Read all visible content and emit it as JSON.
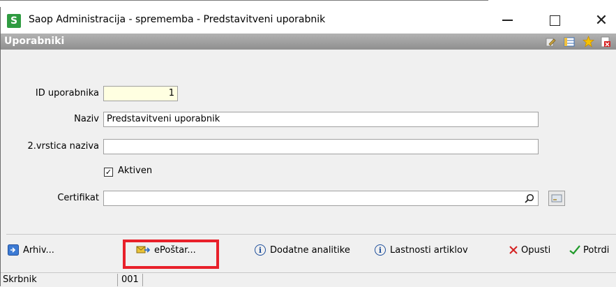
{
  "window": {
    "app_icon_letter": "S",
    "title": "Saop Administracija - sprememba - Predstavitveni uporabnik",
    "minimize_glyph": "minimize",
    "maximize_glyph": "maximize",
    "close_glyph": "✕"
  },
  "header": {
    "title": "Uporabniki",
    "toolbar_icons": [
      "edit-icon",
      "table-icon",
      "star-icon",
      "delete-icon",
      "users-icon"
    ]
  },
  "form": {
    "id_label": "ID uporabnika",
    "id_value": "1",
    "naziv_label": "Naziv",
    "naziv_value": "Predstavitveni uporabnik",
    "vrstica2_label": "2.vrstica naziva",
    "vrstica2_value": "",
    "aktiven_label": "Aktiven",
    "aktiven_checked": true,
    "certifikat_label": "Certifikat",
    "certifikat_value": ""
  },
  "buttons": {
    "arhiv": "Arhiv...",
    "epostar": "ePoštar...",
    "dodatne_analitike": "Dodatne analitike",
    "lastnosti_artiklov": "Lastnosti artiklov",
    "opusti": "Opusti",
    "potrdi": "Potrdi"
  },
  "status": {
    "skrbnik": "Skrbnik",
    "code": "001"
  },
  "colors": {
    "highlight": "#e8202a",
    "id_field_bg": "#ffffe1",
    "app_icon_bg": "#2f9b41"
  }
}
